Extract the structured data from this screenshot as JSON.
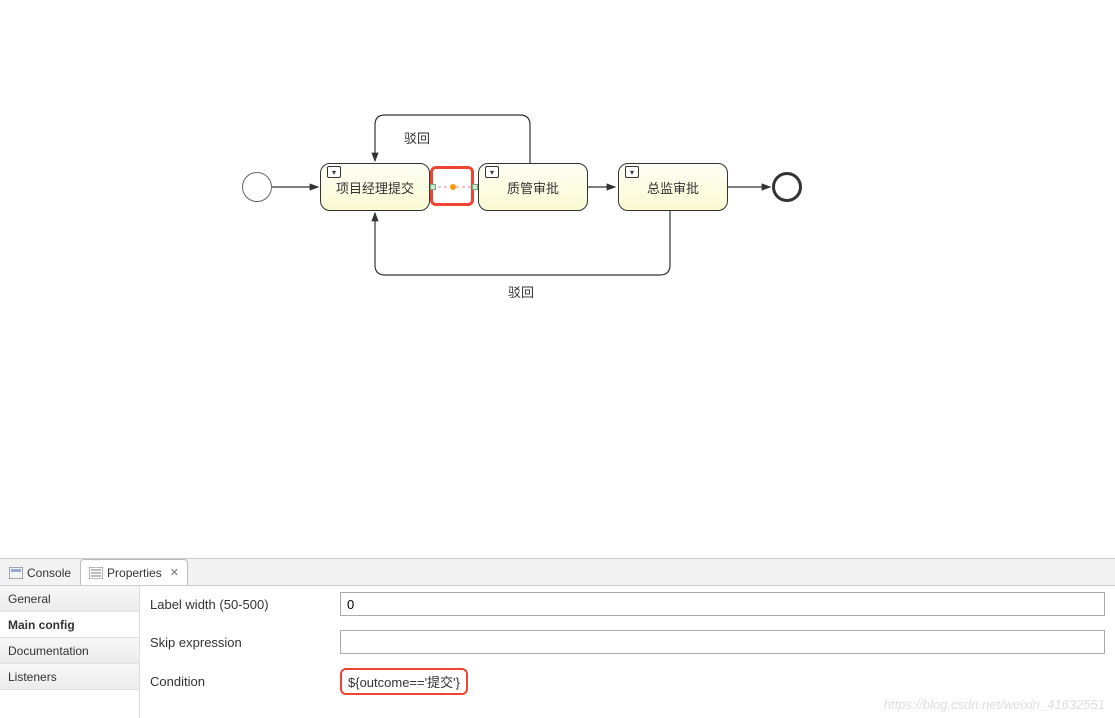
{
  "diagram": {
    "tasks": [
      {
        "label": "项目经理提交"
      },
      {
        "label": "质管审批"
      },
      {
        "label": "总监审批"
      }
    ],
    "labels": {
      "reject_top": "驳回",
      "reject_bottom": "驳回"
    }
  },
  "tabs": {
    "console": "Console",
    "properties": "Properties"
  },
  "side_tabs": {
    "general": "General",
    "main_config": "Main config",
    "documentation": "Documentation",
    "listeners": "Listeners"
  },
  "form": {
    "label_width_label": "Label width (50-500)",
    "label_width_value": "0",
    "skip_expression_label": "Skip expression",
    "skip_expression_value": "",
    "condition_label": "Condition",
    "condition_value": "${outcome=='提交'}"
  },
  "watermark": "https://blog.csdn.net/weixin_41632551"
}
